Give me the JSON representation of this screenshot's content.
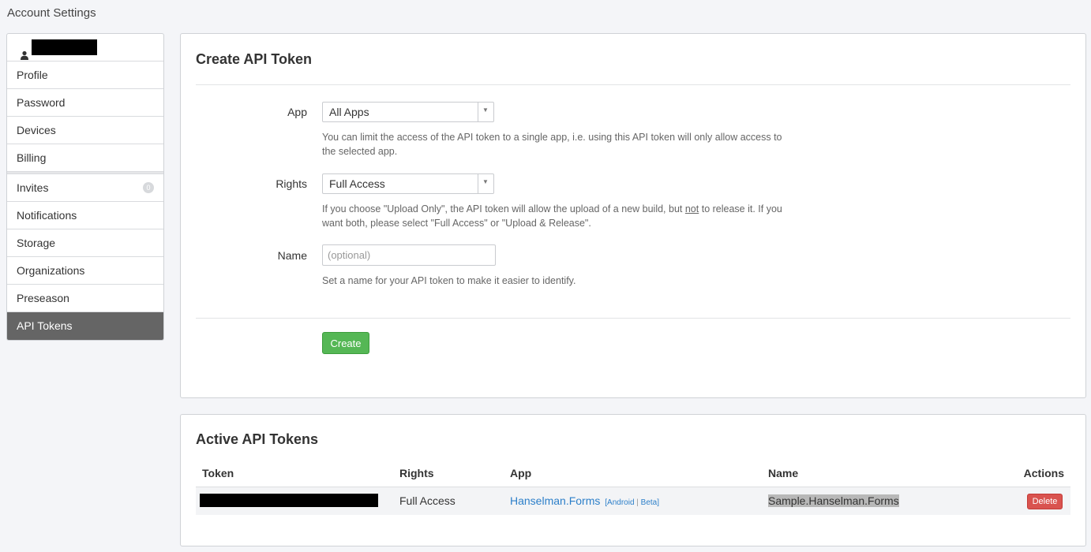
{
  "page": {
    "title": "Account Settings"
  },
  "sidebar": {
    "user_icon": "user-icon",
    "items": [
      {
        "label": "Profile"
      },
      {
        "label": "Password"
      },
      {
        "label": "Devices"
      },
      {
        "label": "Billing"
      },
      {
        "label": "Invites",
        "badge": "0"
      },
      {
        "label": "Notifications"
      },
      {
        "label": "Storage"
      },
      {
        "label": "Organizations"
      },
      {
        "label": "Preseason"
      },
      {
        "label": "API Tokens",
        "active": true
      }
    ]
  },
  "create_panel": {
    "title": "Create API Token",
    "app": {
      "label": "App",
      "value": "All Apps",
      "help": "You can limit the access of the API token to a single app, i.e. using this API token will only allow access to the selected app."
    },
    "rights": {
      "label": "Rights",
      "value": "Full Access",
      "help_before": "If you choose \"Upload Only\", the API token will allow the upload of a new build, but ",
      "help_underlined": "not",
      "help_after": " to release it. If you want both, please select \"Full Access\" or \"Upload & Release\"."
    },
    "name": {
      "label": "Name",
      "value": "",
      "placeholder": "(optional)",
      "help": "Set a name for your API token to make it easier to identify."
    },
    "create_button": "Create"
  },
  "tokens_panel": {
    "title": "Active API Tokens",
    "columns": [
      "Token",
      "Rights",
      "App",
      "Name",
      "Actions"
    ],
    "rows": [
      {
        "rights": "Full Access",
        "app_name": "Hanselman.Forms",
        "app_tag_open": "[",
        "app_platform": "Android",
        "app_tag_sep": " | ",
        "app_channel": "Beta",
        "app_tag_close": "]",
        "name": "Sample.Hanselman.Forms",
        "action": "Delete"
      }
    ]
  },
  "colors": {
    "active_sidebar": "#656565",
    "create_button": "#55b755",
    "delete_button": "#d9534f",
    "link": "#2c7fc9"
  }
}
